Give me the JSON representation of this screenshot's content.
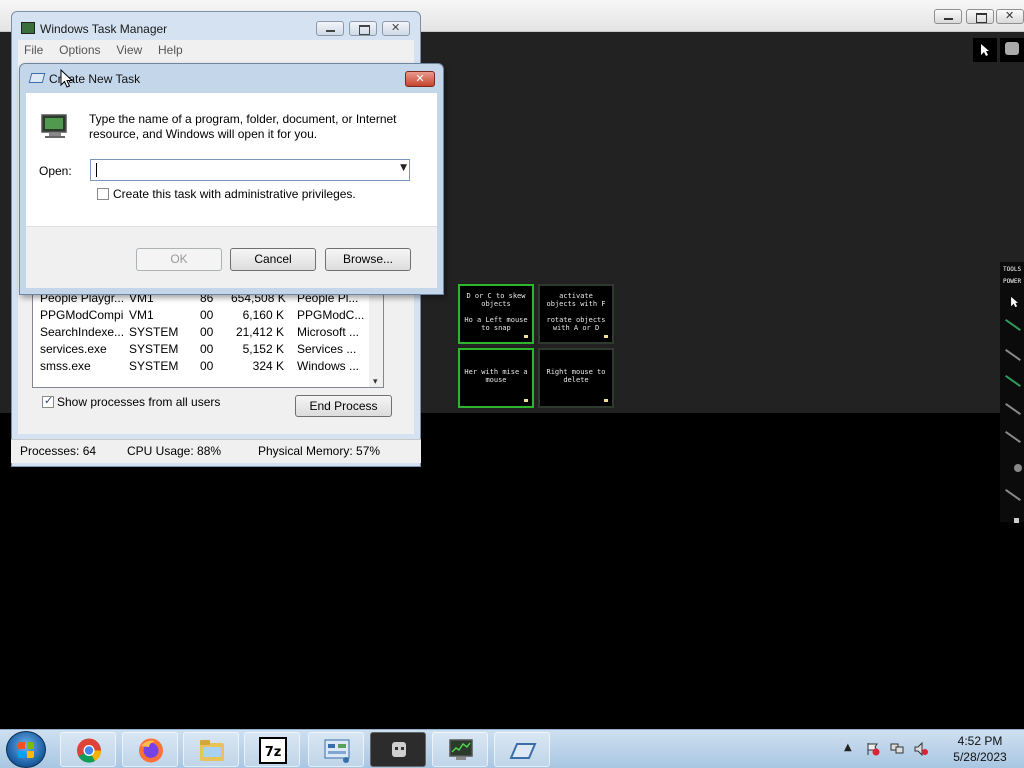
{
  "task_manager": {
    "title": "Windows Task Manager",
    "menu": [
      "File",
      "Options",
      "View",
      "Help"
    ],
    "processes": [
      {
        "name": "People Playgr...",
        "user": "VM1",
        "cpu": "86",
        "memory": "654,508 K",
        "description": "People Pl..."
      },
      {
        "name": "PPGModCompi...",
        "user": "VM1",
        "cpu": "00",
        "memory": "6,160 K",
        "description": "PPGModC..."
      },
      {
        "name": "SearchIndexe...",
        "user": "SYSTEM",
        "cpu": "00",
        "memory": "21,412 K",
        "description": "Microsoft ..."
      },
      {
        "name": "services.exe",
        "user": "SYSTEM",
        "cpu": "00",
        "memory": "5,152 K",
        "description": "Services ..."
      },
      {
        "name": "smss.exe",
        "user": "SYSTEM",
        "cpu": "00",
        "memory": "324 K",
        "description": "Windows ..."
      }
    ],
    "show_all_label": "Show processes from all users",
    "show_all_checked": true,
    "end_process_label": "End Process",
    "status": {
      "processes": "Processes: 64",
      "cpu": "CPU Usage: 88%",
      "memory": "Physical Memory: 57%"
    }
  },
  "run_dialog": {
    "title": "Create New Task",
    "description": "Type the name of a program, folder, document, or Internet resource, and Windows will open it for you.",
    "open_label": "Open:",
    "open_value": "",
    "admin_label": "Create this task with administrative privileges.",
    "admin_checked": false,
    "ok_label": "OK",
    "cancel_label": "Cancel",
    "browse_label": "Browse..."
  },
  "game": {
    "hint_tiles": [
      {
        "line1": "D or C to skew objects",
        "line2": "Ho a Left mouse to snap",
        "active": true
      },
      {
        "line1": "activate objects with F",
        "line2": "rotate objects with A or D",
        "active": false
      },
      {
        "line1": "Her with mise a mouse",
        "line2": "",
        "active": true
      },
      {
        "line1": "Right mouse to delete",
        "line2": "",
        "active": false
      }
    ],
    "side_labels": [
      "TOOLS",
      "POWER"
    ]
  },
  "taskbar": {
    "items": [
      "chrome-icon",
      "firefox-icon",
      "file-explorer-icon",
      "7zip-icon",
      "control-panel-icon",
      "people-playground-icon",
      "task-manager-icon",
      "run-dialog-icon"
    ],
    "time": "4:52 PM",
    "date": "5/28/2023"
  }
}
